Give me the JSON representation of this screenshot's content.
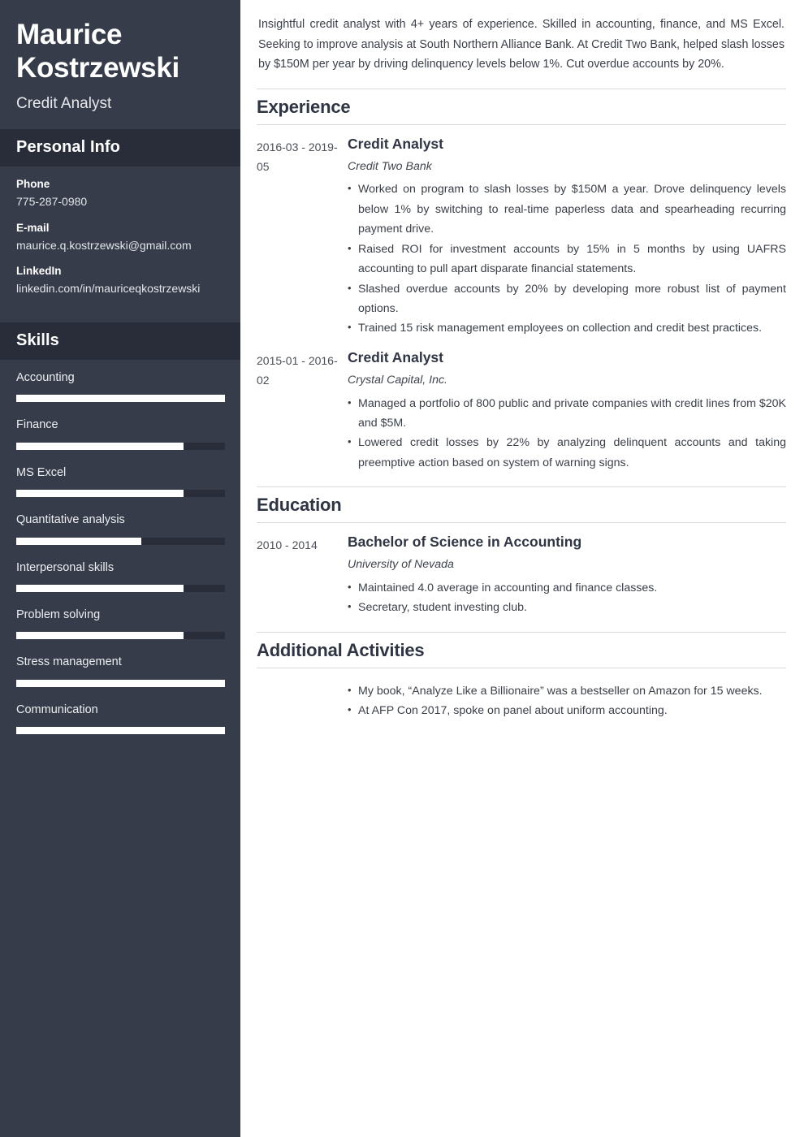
{
  "theme": {
    "sidebar_bg": "#363c49",
    "sidebar_header_bg": "#282d39",
    "bar_fill": "#ffffff",
    "bar_track": "#282d39",
    "heading_color": "#2f3542",
    "body_text": "#3a3f48",
    "rule_color": "#d8dade"
  },
  "sidebar": {
    "name": "Maurice Kostrzewski",
    "job_title": "Credit Analyst",
    "personal_info": {
      "heading": "Personal Info",
      "items": [
        {
          "label": "Phone",
          "value": "775-287-0980"
        },
        {
          "label": "E-mail",
          "value": "maurice.q.kostrzewski@gmail.com"
        },
        {
          "label": "LinkedIn",
          "value": "linkedin.com/in/mauriceqkostrzewski"
        }
      ]
    },
    "skills": {
      "heading": "Skills",
      "items": [
        {
          "name": "Accounting",
          "level": 100
        },
        {
          "name": "Finance",
          "level": 80
        },
        {
          "name": "MS Excel",
          "level": 80
        },
        {
          "name": "Quantitative analysis",
          "level": 60
        },
        {
          "name": "Interpersonal skills",
          "level": 80
        },
        {
          "name": "Problem solving",
          "level": 80
        },
        {
          "name": "Stress management",
          "level": 100
        },
        {
          "name": "Communication",
          "level": 100
        }
      ]
    }
  },
  "main": {
    "summary": "Insightful credit analyst with 4+ years of experience. Skilled in accounting, finance, and MS Excel. Seeking to improve analysis at South Northern Alliance Bank. At Credit Two Bank, helped slash losses by $150M per year by driving delinquency levels below 1%. Cut overdue accounts by 20%.",
    "experience": {
      "title": "Experience",
      "entries": [
        {
          "dates": "2016-03 - 2019-05",
          "role": "Credit Analyst",
          "org": "Credit Two Bank",
          "bullets": [
            "Worked on program to slash losses by $150M a year. Drove delinquency levels below 1% by switching to real-time paperless data and spearheading recurring payment drive.",
            "Raised ROI for investment accounts by 15% in 5 months by using UAFRS accounting to pull apart disparate financial statements.",
            "Slashed overdue accounts by 20% by developing more robust list of payment options.",
            "Trained 15 risk management employees on collection and credit best practices."
          ]
        },
        {
          "dates": "2015-01 - 2016-02",
          "role": "Credit Analyst",
          "org": "Crystal Capital, Inc.",
          "bullets": [
            "Managed a portfolio of 800 public and private companies with credit lines from $20K and $5M.",
            "Lowered credit losses by 22% by analyzing delinquent accounts and taking preemptive action based on system of warning signs."
          ]
        }
      ]
    },
    "education": {
      "title": "Education",
      "entries": [
        {
          "dates": "2010 - 2014",
          "degree": "Bachelor of Science in Accounting",
          "school": "University of Nevada",
          "bullets": [
            "Maintained 4.0 average in accounting and finance classes.",
            "Secretary, student investing club."
          ]
        }
      ]
    },
    "additional_activities": {
      "title": "Additional Activities",
      "bullets": [
        "My book, “Analyze Like a Billionaire” was a bestseller on Amazon for 15 weeks.",
        "At AFP Con 2017, spoke on panel about uniform accounting."
      ]
    }
  }
}
